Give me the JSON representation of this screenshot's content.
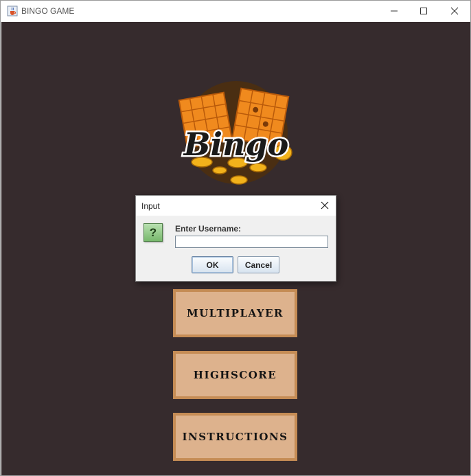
{
  "window": {
    "title": "BINGO GAME",
    "icon": "java-cup-icon",
    "controls": [
      "minimize-icon",
      "maximize-icon",
      "close-icon"
    ]
  },
  "logo": {
    "text": "Bingo",
    "colors": {
      "background": "#4a2e12",
      "cards": "#f08a1e",
      "coins": "#f2b21b",
      "text": "#1a1a1a"
    }
  },
  "menu": {
    "multiplayer_label": "MULTIPLAYER",
    "highscore_label": "HIGHSCORE",
    "instructions_label": "INSTRUCTIONS"
  },
  "dialog": {
    "title": "Input",
    "icon": "question-icon",
    "icon_glyph": "?",
    "prompt": "Enter Username:",
    "username_value": "",
    "ok_label": "OK",
    "cancel_label": "Cancel"
  },
  "colors": {
    "content_background": "#362b2d",
    "menu_button_fill": "#ddb28d",
    "menu_button_border": "#c58c55"
  }
}
